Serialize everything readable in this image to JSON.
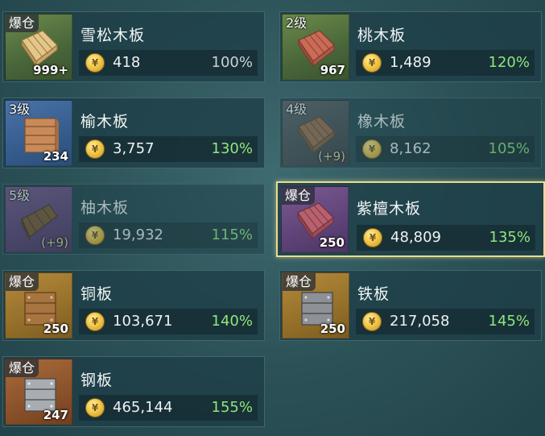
{
  "items": [
    {
      "name": "雪松木板",
      "tag": "爆仓",
      "count": "999+",
      "price": "418",
      "pct": "100%"
    },
    {
      "name": "桃木板",
      "tag": "2级",
      "count": "967",
      "price": "1,489",
      "pct": "120%"
    },
    {
      "name": "榆木板",
      "tag": "3级",
      "count": "234",
      "price": "3,757",
      "pct": "130%"
    },
    {
      "name": "橡木板",
      "tag": "4级",
      "count": "(+9)",
      "price": "8,162",
      "pct": "105%"
    },
    {
      "name": "柚木板",
      "tag": "5级",
      "count": "(+9)",
      "price": "19,932",
      "pct": "115%"
    },
    {
      "name": "紫檀木板",
      "tag": "爆仓",
      "count": "250",
      "price": "48,809",
      "pct": "135%"
    },
    {
      "name": "铜板",
      "tag": "爆仓",
      "count": "250",
      "price": "103,671",
      "pct": "140%"
    },
    {
      "name": "铁板",
      "tag": "爆仓",
      "count": "250",
      "price": "217,058",
      "pct": "145%"
    },
    {
      "name": "钢板",
      "tag": "爆仓",
      "count": "247",
      "price": "465,144",
      "pct": "155%"
    }
  ],
  "colors": {
    "pct_green": "#8fe77c",
    "pct_neutral": "#c9d3d4",
    "selected_border": "#e9dc8e"
  },
  "icons": {
    "currency": "gold-coin-icon",
    "item": "plank-icon"
  }
}
